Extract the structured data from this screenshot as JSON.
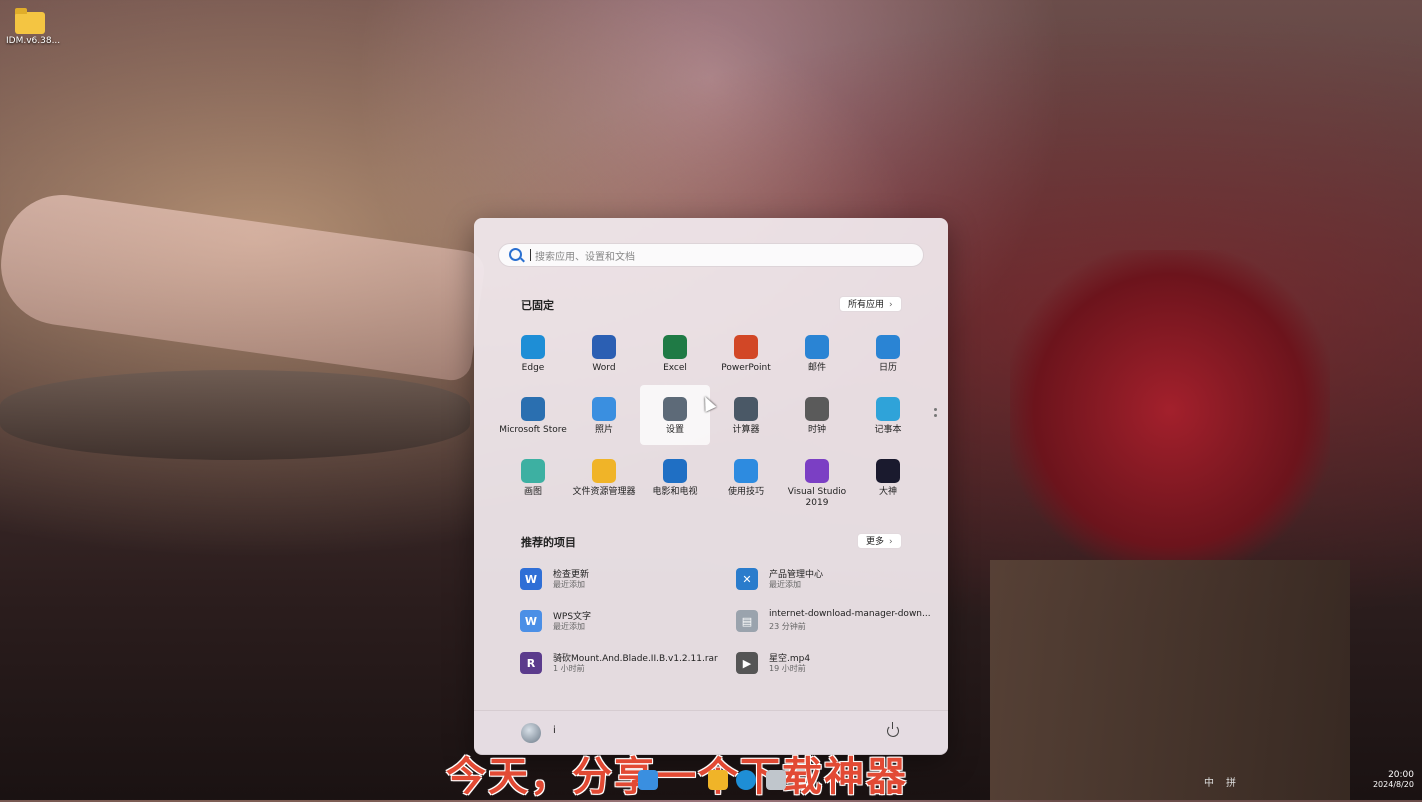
{
  "desktop": {
    "icon_label": "IDM.v6.38..."
  },
  "search": {
    "placeholder": "搜索应用、设置和文档"
  },
  "pinned": {
    "title": "已固定",
    "all_apps_label": "所有应用",
    "apps": [
      {
        "label": "Edge",
        "icon": "edge-icon",
        "color": "#1e8ed6"
      },
      {
        "label": "Word",
        "icon": "word-icon",
        "color": "#2b5fb3"
      },
      {
        "label": "Excel",
        "icon": "excel-icon",
        "color": "#1f7a45"
      },
      {
        "label": "PowerPoint",
        "icon": "powerpoint-icon",
        "color": "#d24726"
      },
      {
        "label": "邮件",
        "icon": "mail-icon",
        "color": "#2a84d4"
      },
      {
        "label": "日历",
        "icon": "calendar-icon",
        "color": "#2a84d4"
      },
      {
        "label": "Microsoft Store",
        "icon": "store-icon",
        "color": "#2a6fb0"
      },
      {
        "label": "照片",
        "icon": "photos-icon",
        "color": "#3a8fe0"
      },
      {
        "label": "设置",
        "icon": "gear-icon",
        "color": "#5d6a78"
      },
      {
        "label": "计算器",
        "icon": "calculator-icon",
        "color": "#4a5866"
      },
      {
        "label": "时钟",
        "icon": "clock-icon",
        "color": "#5a5a5a"
      },
      {
        "label": "记事本",
        "icon": "notepad-icon",
        "color": "#2fa3d9"
      },
      {
        "label": "画图",
        "icon": "paint-icon",
        "color": "#3db0a2"
      },
      {
        "label": "文件资源管理器",
        "icon": "folder-icon",
        "color": "#f0b428"
      },
      {
        "label": "电影和电视",
        "icon": "movies-icon",
        "color": "#1f6fc4"
      },
      {
        "label": "使用技巧",
        "icon": "tips-icon",
        "color": "#2d8be0"
      },
      {
        "label": "Visual Studio 2019",
        "icon": "visual-studio-icon",
        "color": "#7b3fc4"
      },
      {
        "label": "大神",
        "icon": "dashen-icon",
        "color": "#1a1a2e"
      }
    ]
  },
  "recommended": {
    "title": "推荐的项目",
    "more_label": "更多",
    "items": [
      {
        "name": "检查更新",
        "detail": "最近添加",
        "icon": "wps-update-icon",
        "color": "#2f6fd6",
        "glyph": "W"
      },
      {
        "name": "产品管理中心",
        "detail": "最近添加",
        "icon": "tools-icon",
        "color": "#2a7ccc",
        "glyph": "✕"
      },
      {
        "name": "WPS文字",
        "detail": "最近添加",
        "icon": "wps-writer-icon",
        "color": "#4b8fe6",
        "glyph": "W"
      },
      {
        "name": "internet-download-manager-down...",
        "detail": "23 分钟前",
        "icon": "file-icon",
        "color": "#9aa3ad",
        "glyph": "▤"
      },
      {
        "name": "骑砍Mount.And.Blade.II.B.v1.2.11.rar",
        "detail": "1 小时前",
        "icon": "rar-icon",
        "color": "#5b3b8c",
        "glyph": "R"
      },
      {
        "name": "星空.mp4",
        "detail": "19 小时前",
        "icon": "video-file-icon",
        "color": "#555",
        "glyph": "▶"
      }
    ]
  },
  "footer": {
    "username": "i"
  },
  "subtitle": "今天，分享一个下载神器",
  "tray": {
    "input1": "中",
    "input2": "拼",
    "time": "20:00",
    "date": "2024/8/20"
  }
}
